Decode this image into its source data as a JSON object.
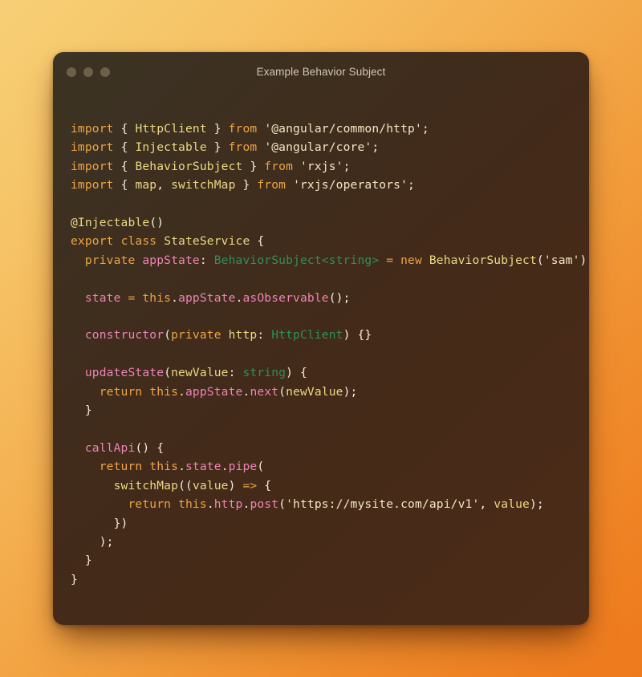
{
  "window": {
    "title": "Example Behavior Subject",
    "traffic_lights": [
      "close-dot",
      "minimize-dot",
      "zoom-dot"
    ],
    "dot_color": "#6d6046",
    "title_color": "#cfc7b8",
    "background_gradient": [
      "#3b3323",
      "#4c2c18"
    ],
    "corner_radius_px": 13
  },
  "backdrop": {
    "gradient_from": "#f7cf76",
    "gradient_to": "#ee7a1d",
    "gradient_angle": "135deg"
  },
  "code": {
    "language": "typescript",
    "font": "monospace",
    "font_size_px": 14.6,
    "line_height_px": 23.4,
    "token_colors": {
      "keyword": "#eda445",
      "identifier": "#ecd884",
      "string": "#f3e7c3",
      "function": "#ed84b6",
      "type": "#2f8f5b",
      "punctuation": "#f4eee2"
    },
    "plain_text": "import { HttpClient } from '@angular/common/http';\nimport { Injectable } from '@angular/core';\nimport { BehaviorSubject } from 'rxjs';\nimport { map, switchMap } from 'rxjs/operators';\n\n@Injectable()\nexport class StateService {\n  private appState: BehaviorSubject<string> = new BehaviorSubject('sam');\n\n  state = this.appState.asObservable();\n\n  constructor(private http: HttpClient) {}\n\n  updateState(newValue: string) {\n    return this.appState.next(newValue);\n  }\n\n  callApi() {\n    return this.state.pipe(\n      switchMap((value) => {\n        return this.http.post('https://mysite.com/api/v1', value);\n      })\n    );\n  }\n}",
    "lines": [
      [
        {
          "t": "import",
          "c": "kw"
        },
        {
          "t": " ",
          "c": "pun"
        },
        {
          "t": "{",
          "c": "pun"
        },
        {
          "t": " ",
          "c": "pun"
        },
        {
          "t": "HttpClient",
          "c": "id"
        },
        {
          "t": " ",
          "c": "pun"
        },
        {
          "t": "}",
          "c": "pun"
        },
        {
          "t": " ",
          "c": "pun"
        },
        {
          "t": "from",
          "c": "kw"
        },
        {
          "t": " ",
          "c": "pun"
        },
        {
          "t": "'@angular/common/http'",
          "c": "str"
        },
        {
          "t": ";",
          "c": "pun"
        }
      ],
      [
        {
          "t": "import",
          "c": "kw"
        },
        {
          "t": " ",
          "c": "pun"
        },
        {
          "t": "{",
          "c": "pun"
        },
        {
          "t": " ",
          "c": "pun"
        },
        {
          "t": "Injectable",
          "c": "id"
        },
        {
          "t": " ",
          "c": "pun"
        },
        {
          "t": "}",
          "c": "pun"
        },
        {
          "t": " ",
          "c": "pun"
        },
        {
          "t": "from",
          "c": "kw"
        },
        {
          "t": " ",
          "c": "pun"
        },
        {
          "t": "'@angular/core'",
          "c": "str"
        },
        {
          "t": ";",
          "c": "pun"
        }
      ],
      [
        {
          "t": "import",
          "c": "kw"
        },
        {
          "t": " ",
          "c": "pun"
        },
        {
          "t": "{",
          "c": "pun"
        },
        {
          "t": " ",
          "c": "pun"
        },
        {
          "t": "BehaviorSubject",
          "c": "id"
        },
        {
          "t": " ",
          "c": "pun"
        },
        {
          "t": "}",
          "c": "pun"
        },
        {
          "t": " ",
          "c": "pun"
        },
        {
          "t": "from",
          "c": "kw"
        },
        {
          "t": " ",
          "c": "pun"
        },
        {
          "t": "'rxjs'",
          "c": "str"
        },
        {
          "t": ";",
          "c": "pun"
        }
      ],
      [
        {
          "t": "import",
          "c": "kw"
        },
        {
          "t": " ",
          "c": "pun"
        },
        {
          "t": "{",
          "c": "pun"
        },
        {
          "t": " ",
          "c": "pun"
        },
        {
          "t": "map",
          "c": "id"
        },
        {
          "t": ", ",
          "c": "pun"
        },
        {
          "t": "switchMap",
          "c": "id"
        },
        {
          "t": " ",
          "c": "pun"
        },
        {
          "t": "}",
          "c": "pun"
        },
        {
          "t": " ",
          "c": "pun"
        },
        {
          "t": "from",
          "c": "kw"
        },
        {
          "t": " ",
          "c": "pun"
        },
        {
          "t": "'rxjs/operators'",
          "c": "str"
        },
        {
          "t": ";",
          "c": "pun"
        }
      ],
      [],
      [
        {
          "t": "@Injectable",
          "c": "id"
        },
        {
          "t": "()",
          "c": "pun"
        }
      ],
      [
        {
          "t": "export",
          "c": "kw"
        },
        {
          "t": " ",
          "c": "pun"
        },
        {
          "t": "class",
          "c": "kw"
        },
        {
          "t": " ",
          "c": "pun"
        },
        {
          "t": "StateService",
          "c": "id"
        },
        {
          "t": " ",
          "c": "pun"
        },
        {
          "t": "{",
          "c": "pun"
        }
      ],
      [
        {
          "t": "  ",
          "c": "pun"
        },
        {
          "t": "private",
          "c": "kw"
        },
        {
          "t": " ",
          "c": "pun"
        },
        {
          "t": "appState",
          "c": "fn"
        },
        {
          "t": ": ",
          "c": "pun"
        },
        {
          "t": "BehaviorSubject<string>",
          "c": "type"
        },
        {
          "t": " ",
          "c": "pun"
        },
        {
          "t": "=",
          "c": "op"
        },
        {
          "t": " ",
          "c": "pun"
        },
        {
          "t": "new",
          "c": "kw"
        },
        {
          "t": " ",
          "c": "pun"
        },
        {
          "t": "BehaviorSubject",
          "c": "id"
        },
        {
          "t": "(",
          "c": "pun"
        },
        {
          "t": "'sam'",
          "c": "str"
        },
        {
          "t": ");",
          "c": "pun"
        }
      ],
      [],
      [
        {
          "t": "  ",
          "c": "pun"
        },
        {
          "t": "state",
          "c": "fn"
        },
        {
          "t": " ",
          "c": "pun"
        },
        {
          "t": "=",
          "c": "op"
        },
        {
          "t": " ",
          "c": "pun"
        },
        {
          "t": "this",
          "c": "kw"
        },
        {
          "t": ".",
          "c": "pun"
        },
        {
          "t": "appState",
          "c": "fn"
        },
        {
          "t": ".",
          "c": "pun"
        },
        {
          "t": "asObservable",
          "c": "fn"
        },
        {
          "t": "();",
          "c": "pun"
        }
      ],
      [],
      [
        {
          "t": "  ",
          "c": "pun"
        },
        {
          "t": "constructor",
          "c": "fn"
        },
        {
          "t": "(",
          "c": "pun"
        },
        {
          "t": "private",
          "c": "kw"
        },
        {
          "t": " ",
          "c": "pun"
        },
        {
          "t": "http",
          "c": "id"
        },
        {
          "t": ": ",
          "c": "pun"
        },
        {
          "t": "HttpClient",
          "c": "type"
        },
        {
          "t": ") {}",
          "c": "pun"
        }
      ],
      [],
      [
        {
          "t": "  ",
          "c": "pun"
        },
        {
          "t": "updateState",
          "c": "fn"
        },
        {
          "t": "(",
          "c": "pun"
        },
        {
          "t": "newValue",
          "c": "id"
        },
        {
          "t": ": ",
          "c": "pun"
        },
        {
          "t": "string",
          "c": "type"
        },
        {
          "t": ") {",
          "c": "pun"
        }
      ],
      [
        {
          "t": "    ",
          "c": "pun"
        },
        {
          "t": "return",
          "c": "kw"
        },
        {
          "t": " ",
          "c": "pun"
        },
        {
          "t": "this",
          "c": "kw"
        },
        {
          "t": ".",
          "c": "pun"
        },
        {
          "t": "appState",
          "c": "fn"
        },
        {
          "t": ".",
          "c": "pun"
        },
        {
          "t": "next",
          "c": "fn"
        },
        {
          "t": "(",
          "c": "pun"
        },
        {
          "t": "newValue",
          "c": "id"
        },
        {
          "t": ");",
          "c": "pun"
        }
      ],
      [
        {
          "t": "  }",
          "c": "pun"
        }
      ],
      [],
      [
        {
          "t": "  ",
          "c": "pun"
        },
        {
          "t": "callApi",
          "c": "fn"
        },
        {
          "t": "() {",
          "c": "pun"
        }
      ],
      [
        {
          "t": "    ",
          "c": "pun"
        },
        {
          "t": "return",
          "c": "kw"
        },
        {
          "t": " ",
          "c": "pun"
        },
        {
          "t": "this",
          "c": "kw"
        },
        {
          "t": ".",
          "c": "pun"
        },
        {
          "t": "state",
          "c": "fn"
        },
        {
          "t": ".",
          "c": "pun"
        },
        {
          "t": "pipe",
          "c": "fn"
        },
        {
          "t": "(",
          "c": "pun"
        }
      ],
      [
        {
          "t": "      ",
          "c": "pun"
        },
        {
          "t": "switchMap",
          "c": "id"
        },
        {
          "t": "((",
          "c": "pun"
        },
        {
          "t": "value",
          "c": "id"
        },
        {
          "t": ") ",
          "c": "pun"
        },
        {
          "t": "=>",
          "c": "op"
        },
        {
          "t": " {",
          "c": "pun"
        }
      ],
      [
        {
          "t": "        ",
          "c": "pun"
        },
        {
          "t": "return",
          "c": "kw"
        },
        {
          "t": " ",
          "c": "pun"
        },
        {
          "t": "this",
          "c": "kw"
        },
        {
          "t": ".",
          "c": "pun"
        },
        {
          "t": "http",
          "c": "fn"
        },
        {
          "t": ".",
          "c": "pun"
        },
        {
          "t": "post",
          "c": "fn"
        },
        {
          "t": "(",
          "c": "pun"
        },
        {
          "t": "'https://mysite.com/api/v1'",
          "c": "str"
        },
        {
          "t": ", ",
          "c": "pun"
        },
        {
          "t": "value",
          "c": "id"
        },
        {
          "t": ");",
          "c": "pun"
        }
      ],
      [
        {
          "t": "      })",
          "c": "pun"
        }
      ],
      [
        {
          "t": "    );",
          "c": "pun"
        }
      ],
      [
        {
          "t": "  }",
          "c": "pun"
        }
      ],
      [
        {
          "t": "}",
          "c": "pun"
        }
      ]
    ]
  }
}
